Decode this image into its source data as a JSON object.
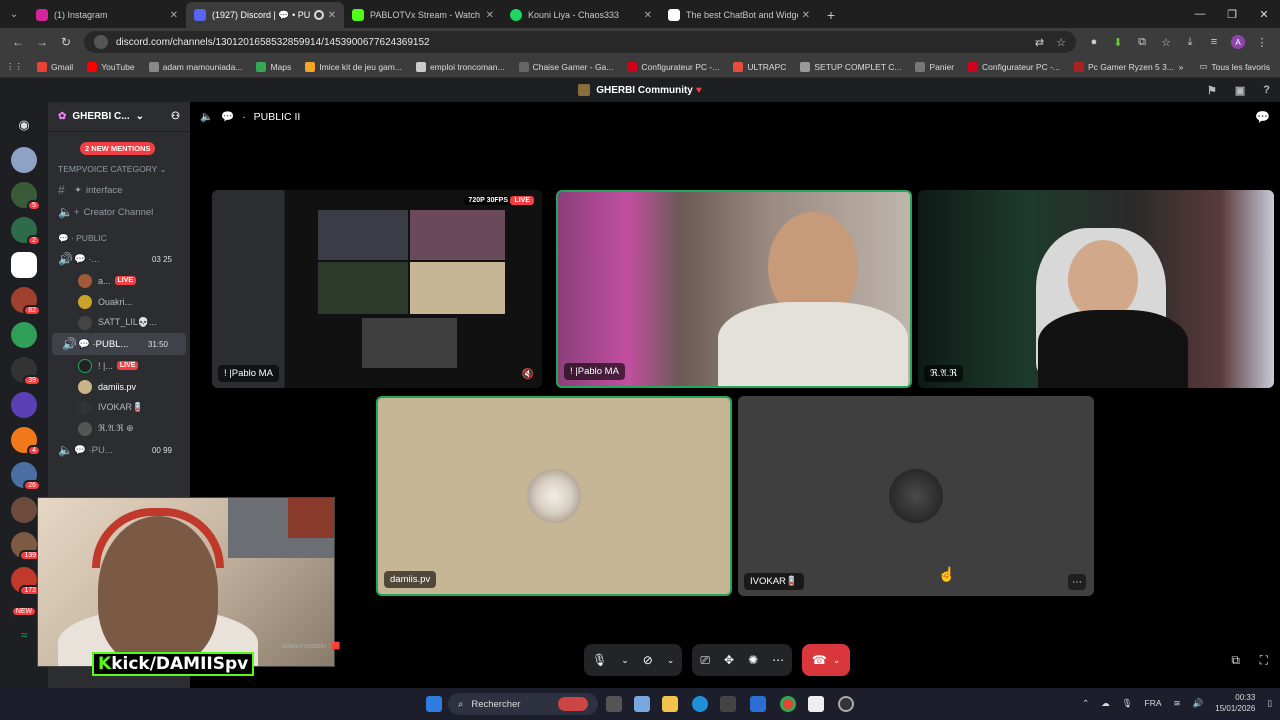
{
  "browser": {
    "tabs": [
      {
        "title": "(1) Instagram",
        "color": "#d6249f",
        "active": false
      },
      {
        "title": "(1927) Discord | 💬 • PUBLI",
        "color": "#5865f2",
        "active": true
      },
      {
        "title": "PABLOTVx Stream - Watch Live",
        "color": "#53fc18",
        "active": false
      },
      {
        "title": "Kouni Liya - Chaos333",
        "color": "#1ed760",
        "active": false
      },
      {
        "title": "The best ChatBot and Widgets",
        "color": "#ffffff",
        "active": false
      }
    ],
    "url": "discord.com/channels/1301201658532859914/1453900677624369152",
    "bookmarks": [
      {
        "label": "Gmail",
        "color": "#ea4335"
      },
      {
        "label": "YouTube",
        "color": "#ff0000"
      },
      {
        "label": "adam mamouniada...",
        "color": "#888888"
      },
      {
        "label": "Maps",
        "color": "#34a853"
      },
      {
        "label": "Imice kit de jeu gam...",
        "color": "#f5a623"
      },
      {
        "label": "emploi troncoman...",
        "color": "#cccccc"
      },
      {
        "label": "Chaise Gamer - Ga...",
        "color": "#666666"
      },
      {
        "label": "Configurateur PC -...",
        "color": "#d0021b"
      },
      {
        "label": "ULTRAPC",
        "color": "#e74c3c"
      },
      {
        "label": "SETUP COMPLET C...",
        "color": "#999999"
      },
      {
        "label": "Panier",
        "color": "#777777"
      },
      {
        "label": "Configurateur PC -...",
        "color": "#d0021b"
      },
      {
        "label": "Pc Gamer Ryzen 5 3...",
        "color": "#aa2222"
      }
    ],
    "all_bookmarks": "Tous les favoris"
  },
  "discord": {
    "window_title": "GHERBI Community",
    "server_name": "GHERBI C...",
    "new_mentions": "2 NEW MENTIONS",
    "category_tempvoice": "TEMPVOICE CATEGORY",
    "channel_interface": "interface",
    "channel_creator": "Creator Channel",
    "category_public": "PUBLIC",
    "voice1": {
      "name": "...",
      "count_a": "03",
      "count_b": "25"
    },
    "voice1_users": [
      {
        "name": "a...",
        "live": "LIVE",
        "color": "#a05a3a"
      },
      {
        "name": "Ouakri...",
        "live": "",
        "color": "#c9a227"
      },
      {
        "name": "SATT_LIL💀...",
        "live": "",
        "color": "#444444"
      }
    ],
    "voice2": {
      "name": "PUBL...",
      "time": "31:50"
    },
    "voice2_users": [
      {
        "name": "! |...",
        "live": "LIVE",
        "color": "#222222"
      },
      {
        "name": "damiis.pv",
        "live": "",
        "color": "#c9b48a"
      },
      {
        "name": "IVOKAR🪫",
        "live": "",
        "color": "#333333"
      },
      {
        "name": "ℜ.𝔄.ℜ ⊕",
        "live": "",
        "color": "#555555"
      }
    ],
    "voice3": {
      "name": "PU...",
      "count_a": "00",
      "count_b": "99"
    },
    "stage_title": "PUBLIC II",
    "tiles": {
      "screen": {
        "name": "! |Pablo MA",
        "quality": "720P 30FPS",
        "live": "LIVE"
      },
      "cam1": {
        "name": "! |Pablo MA"
      },
      "cam2": {
        "name": "ℜ.𝔄.ℜ"
      },
      "damiis": {
        "name": "damiis.pv",
        "bg": "#c7b695"
      },
      "ivokar": {
        "name": "IVOKAR🪫",
        "bg": "#3f3f3f"
      }
    },
    "guild_badges": [
      "5",
      "2",
      "82",
      "39",
      "4",
      "26",
      "139",
      "172",
      "NEW"
    ]
  },
  "overlay": {
    "kick_label": "kick/DAMIISpv",
    "chat_line": "adaminepablo : 🟥"
  },
  "taskbar": {
    "search_placeholder": "Rechercher",
    "lang": "FRA",
    "time": "00:33",
    "date": "15/01/2026"
  }
}
